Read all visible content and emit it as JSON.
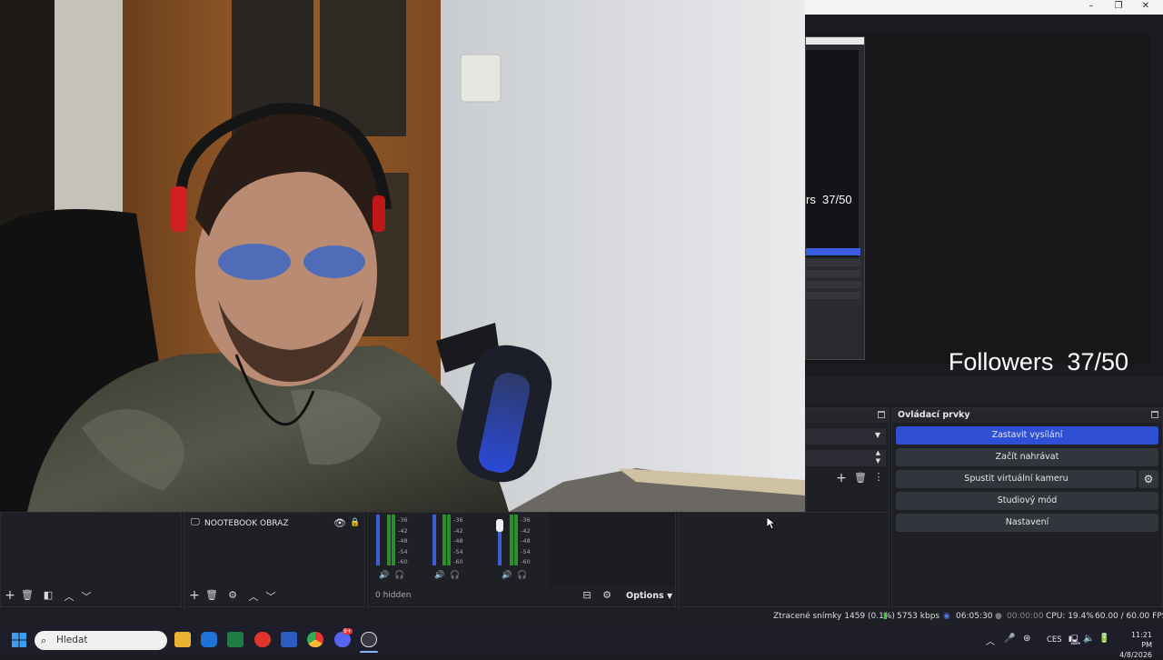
{
  "window": {
    "minimize_glyph": "–",
    "restore_glyph": "❐",
    "close_glyph": "✕"
  },
  "preview": {
    "followers_text": "Followers  37/50",
    "nested_followers_text": "rs  37/50"
  },
  "controls": {
    "title": "Ovládací prvky",
    "stop_stream": "Zastavit vysílání",
    "start_recording": "Začít nahrávat",
    "start_virtual_camera": "Spustit virtuální kameru",
    "studio_mode": "Studiový mód",
    "settings": "Nastavení"
  },
  "sources": {
    "item_label": "NOOTEBOOK OBRAZ"
  },
  "mixer": {
    "scale": [
      "-36",
      "-42",
      "-48",
      "-54",
      "-60"
    ],
    "hidden_label": "0 hidden",
    "options_label": "Options"
  },
  "status": {
    "dropped_frames": "Ztracené snímky 1459 (0.1%)",
    "bitrate": "5753 kbps",
    "stream_time": "06:05:30",
    "record_time": "00:00:00",
    "cpu": "CPU: 19.4%",
    "fps": "60.00 / 60.00 FPS"
  },
  "taskbar": {
    "search_placeholder": "Hledat",
    "language": "CES",
    "time": "11:21 PM",
    "date": "4/8/2026",
    "discord_badge": "9+"
  },
  "colors": {
    "accent_blue": "#2f50d5",
    "meter_green": "#2c8f2c",
    "panel_bg": "#1f2026"
  }
}
